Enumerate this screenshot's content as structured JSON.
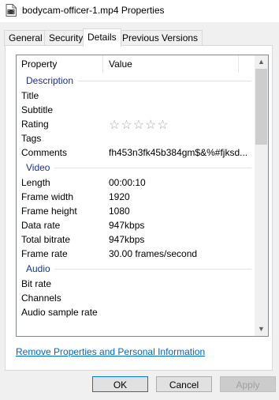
{
  "window": {
    "title": "bodycam-officer-1.mp4 Properties",
    "icon": "video-file-icon"
  },
  "tabs": [
    {
      "label": "General",
      "active": false
    },
    {
      "label": "Security",
      "active": false
    },
    {
      "label": "Details",
      "active": true
    },
    {
      "label": "Previous Versions",
      "active": false
    }
  ],
  "details": {
    "header": {
      "property": "Property",
      "value": "Value"
    },
    "groups": [
      {
        "label": "Description",
        "rows": [
          {
            "property": "Title",
            "value": ""
          },
          {
            "property": "Subtitle",
            "value": ""
          },
          {
            "property": "Rating",
            "value": "",
            "rating_stars": 0,
            "rating_max": 5
          },
          {
            "property": "Tags",
            "value": ""
          },
          {
            "property": "Comments",
            "value": "fh453n3fk45b384gm$&%#fjksd..."
          }
        ]
      },
      {
        "label": "Video",
        "rows": [
          {
            "property": "Length",
            "value": "00:00:10"
          },
          {
            "property": "Frame width",
            "value": "1920"
          },
          {
            "property": "Frame height",
            "value": "1080"
          },
          {
            "property": "Data rate",
            "value": "947kbps"
          },
          {
            "property": "Total bitrate",
            "value": "947kbps"
          },
          {
            "property": "Frame rate",
            "value": "30.00 frames/second"
          }
        ]
      },
      {
        "label": "Audio",
        "rows": [
          {
            "property": "Bit rate",
            "value": ""
          },
          {
            "property": "Channels",
            "value": ""
          },
          {
            "property": "Audio sample rate",
            "value": ""
          }
        ]
      }
    ]
  },
  "remove_link": "Remove Properties and Personal Information",
  "buttons": {
    "ok": "OK",
    "cancel": "Cancel",
    "apply": "Apply"
  },
  "colors": {
    "group_label": "#1e3287",
    "link": "#0066cc"
  }
}
